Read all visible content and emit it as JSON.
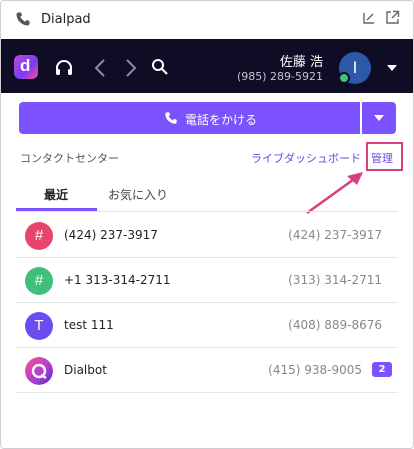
{
  "window": {
    "title": "Dialpad"
  },
  "header": {
    "logo_letter": "d",
    "user_name": "佐藤 浩",
    "user_phone": "(985) 289-5921",
    "avatar_initial": "I"
  },
  "call": {
    "label": "電話をかける"
  },
  "contact_center": {
    "label": "コンタクトセンター",
    "live_dashboard": "ライブダッシュボード",
    "manage": "管理"
  },
  "tabs": [
    {
      "label": "最近",
      "active": true
    },
    {
      "label": "お気に入り",
      "active": false
    }
  ],
  "calls": [
    {
      "avatar": "#",
      "name": "(424) 237-3917",
      "number": "(424) 237-3917",
      "color": "#e8456b",
      "badge": ""
    },
    {
      "avatar": "#",
      "name": "+1 313-314-2711",
      "number": "(313) 314-2711",
      "color": "#3fbf7a",
      "badge": ""
    },
    {
      "avatar": "T",
      "name": "test 111",
      "number": "(408) 889-8676",
      "color": "#6b4cf0",
      "badge": ""
    },
    {
      "avatar": "",
      "name": "Dialbot",
      "number": "(415) 938-9005",
      "color": "#d23d86",
      "badge": "2"
    }
  ],
  "colors": {
    "accent": "#7c52ff",
    "header_bg": "#0e0d25",
    "annotation": "#d6407e"
  }
}
